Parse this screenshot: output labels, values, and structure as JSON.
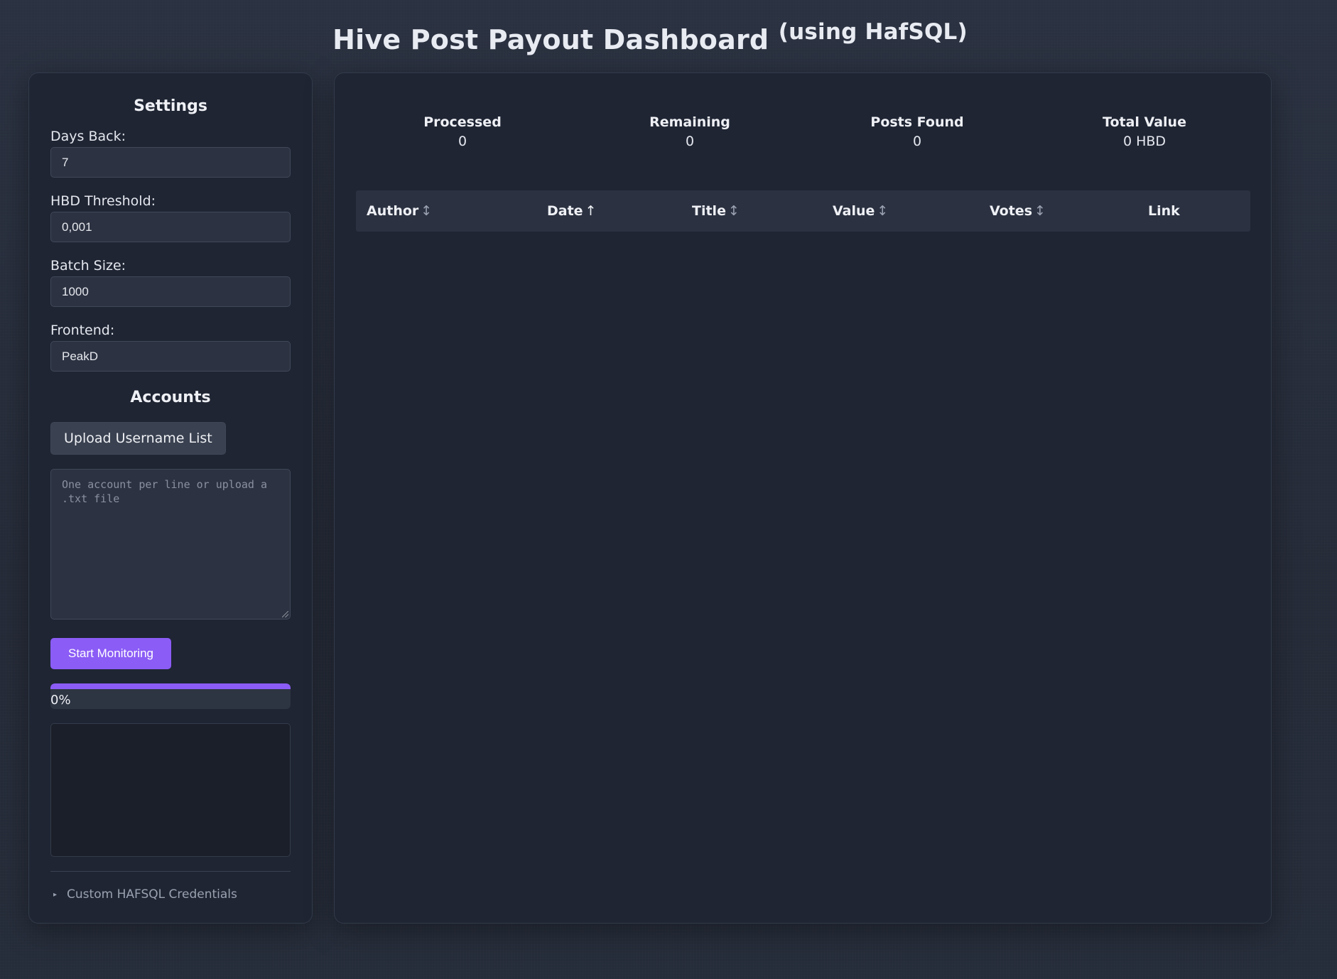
{
  "header": {
    "title": "Hive Post Payout Dashboard",
    "subtitle": "(using HafSQL)"
  },
  "settings": {
    "title": "Settings",
    "days_back": {
      "label": "Days Back:",
      "value": "7"
    },
    "hbd_threshold": {
      "label": "HBD Threshold:",
      "value": "0,001"
    },
    "batch_size": {
      "label": "Batch Size:",
      "value": "1000"
    },
    "frontend": {
      "label": "Frontend:",
      "value": "PeakD"
    }
  },
  "accounts": {
    "title": "Accounts",
    "upload_label": "Upload Username List",
    "textarea_placeholder": "One account per line or upload a .txt file",
    "textarea_value": ""
  },
  "monitor": {
    "start_label": "Start Monitoring",
    "progress_text": "0%",
    "progress_fraction": 1.0,
    "log_text": ""
  },
  "credentials": {
    "summary_label": "Custom HAFSQL Credentials",
    "expanded": false
  },
  "stats": [
    {
      "label": "Processed",
      "value": "0"
    },
    {
      "label": "Remaining",
      "value": "0"
    },
    {
      "label": "Posts Found",
      "value": "0"
    },
    {
      "label": "Total Value",
      "value": "0 HBD"
    }
  ],
  "table": {
    "columns": [
      {
        "label": "Author",
        "sort_glyph": "↕",
        "active": false
      },
      {
        "label": "Date",
        "sort_glyph": "↑",
        "active": true
      },
      {
        "label": "Title",
        "sort_glyph": "↕",
        "active": false
      },
      {
        "label": "Value",
        "sort_glyph": "↕",
        "active": false
      },
      {
        "label": "Votes",
        "sort_glyph": "↕",
        "active": false
      },
      {
        "label": "Link",
        "sort_glyph": "",
        "active": false
      }
    ],
    "rows": []
  },
  "icons": {
    "sort_neutral": "sort-both-icon",
    "sort_asc": "sort-ascending-icon",
    "details_toggle": "triangle-right-icon",
    "resize": "resize-grip-icon"
  },
  "colors": {
    "accent": "#8b5cf6",
    "panel_bg": "#1f2533",
    "page_bg": "#262d3b"
  }
}
